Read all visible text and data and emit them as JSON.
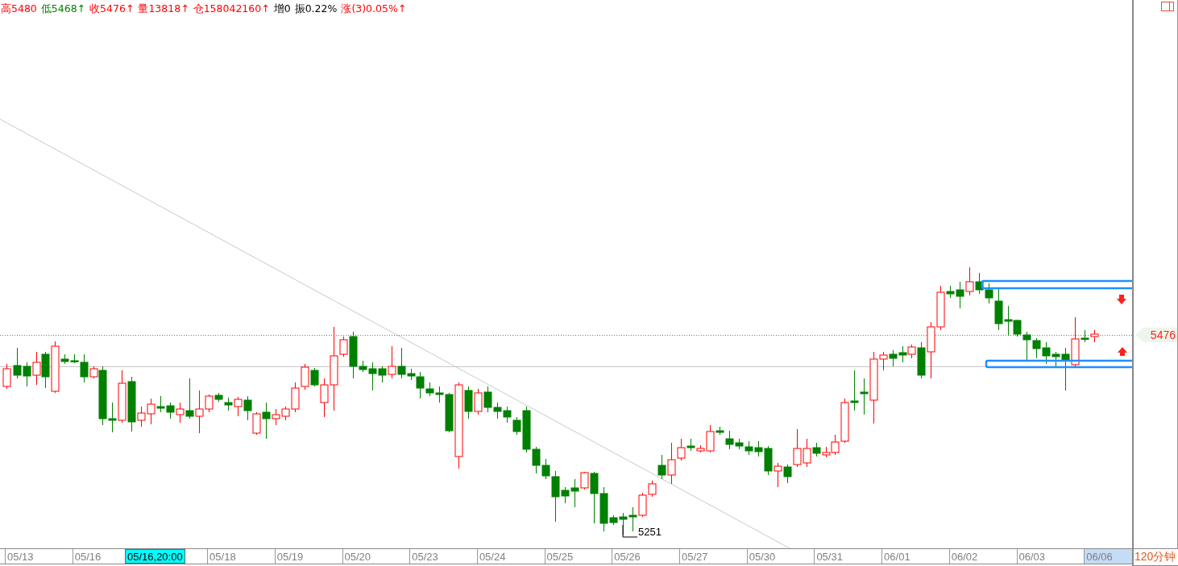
{
  "quote_bar": [
    {
      "text": "高5480",
      "color": "#ff0000"
    },
    {
      "text": "低5468↑",
      "color": "#008000"
    },
    {
      "text": "收5476↑",
      "color": "#ff0000"
    },
    {
      "text": "量13818↑",
      "color": "#ff0000"
    },
    {
      "text": "仓158042160↑",
      "color": "#ff0000"
    },
    {
      "text": "增0",
      "color": "#000000"
    },
    {
      "text": "振0.22%",
      "color": "#000000"
    },
    {
      "text": "涨(3)0.05%↑",
      "color": "#ff0000"
    }
  ],
  "chart": {
    "last_price": "5476",
    "low_label": "5251"
  },
  "time_axis": [
    {
      "text": "05/13",
      "kind": "date",
      "selected": false
    },
    {
      "text": "05/16",
      "kind": "date",
      "selected": false
    },
    {
      "text": "05/16,20:00",
      "kind": "cursor",
      "selected": false
    },
    {
      "text": "05/18",
      "kind": "date",
      "selected": false
    },
    {
      "text": "05/19",
      "kind": "date",
      "selected": false
    },
    {
      "text": "05/20",
      "kind": "date",
      "selected": false
    },
    {
      "text": "05/23",
      "kind": "date",
      "selected": false
    },
    {
      "text": "05/24",
      "kind": "date",
      "selected": false
    },
    {
      "text": "05/25",
      "kind": "date",
      "selected": false
    },
    {
      "text": "05/26",
      "kind": "date",
      "selected": false
    },
    {
      "text": "05/27",
      "kind": "date",
      "selected": false
    },
    {
      "text": "05/30",
      "kind": "date",
      "selected": false
    },
    {
      "text": "05/31",
      "kind": "date",
      "selected": false
    },
    {
      "text": "06/01",
      "kind": "date",
      "selected": false
    },
    {
      "text": "06/02",
      "kind": "date",
      "selected": false
    },
    {
      "text": "06/03",
      "kind": "date",
      "selected": false
    },
    {
      "text": "06/06",
      "kind": "date",
      "selected": true
    }
  ],
  "period": "120分钟"
}
